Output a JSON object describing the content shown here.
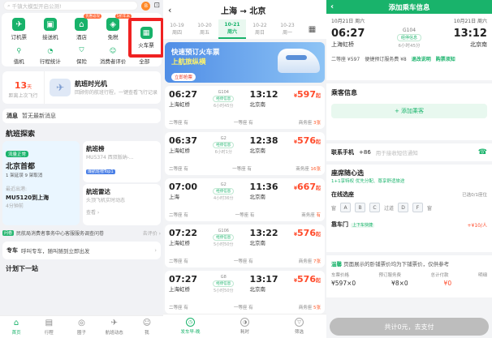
{
  "home": {
    "search_placeholder": "千镇大模型开启公测!",
    "avatar_initial": "B",
    "grid": [
      {
        "label": "订机票",
        "icon": "✈",
        "badge": ""
      },
      {
        "label": "接送机",
        "icon": "🚘",
        "badge": ""
      },
      {
        "label": "酒店",
        "icon": "🏨",
        "badge": "优惠返现"
      },
      {
        "label": "免税",
        "icon": "🛍",
        "badge": "5折年末"
      }
    ],
    "train_label": "火车票",
    "grid2": [
      {
        "label": "值机",
        "icon": "🧳"
      },
      {
        "label": "行程统计",
        "icon": "📊"
      },
      {
        "label": "保险",
        "icon": "🛡"
      },
      {
        "label": "消费者评价",
        "icon": "💬"
      },
      {
        "label": "全部",
        "icon": "⋯"
      }
    ],
    "time_card": {
      "count": "13",
      "unit": "天",
      "sub": "距离上次飞行",
      "title": "航班时光机",
      "desc": "回顾你的航班行程，一键查看飞行记录"
    },
    "messages": {
      "title": "消息",
      "text": "暂无最新消息"
    },
    "explore": {
      "title": "航班探索",
      "status_tag": "流量正常",
      "airport": "北京首都",
      "stats": "1 架延误   9 架取消",
      "recent_label": "最近出港:",
      "flight": "MU5120到上海",
      "flight_time": "4分钟前",
      "rank_title": "航班榜",
      "rank_sub": "MU5374  西双版纳-...",
      "rank_tag": "爆航班榜Top1",
      "radar_title": "航班雷达",
      "radar_sub": "头顶飞机实时动态",
      "radar_link": "查看 ›"
    },
    "ad": {
      "tag": "问卷",
      "text": "民航局消费者事务中心客服服务调查问卷",
      "link": "去评价 ›"
    },
    "car": {
      "title": "专车",
      "text": "呼叫专车，随叫随到立即出发"
    },
    "plan": "计划下一站",
    "tabs": [
      "首页",
      "行程",
      "圈子",
      "航班动态",
      "我"
    ]
  },
  "list": {
    "title": "上海 → 北京",
    "dates": [
      {
        "d": "10-19",
        "w": "周四"
      },
      {
        "d": "10-20",
        "w": "周五"
      },
      {
        "d": "10-21",
        "w": "周六"
      },
      {
        "d": "10-22",
        "w": "周日"
      },
      {
        "d": "10-23",
        "w": "周一"
      }
    ],
    "banner": {
      "l1": "快速预订火车票",
      "l2": "上航旅纵横",
      "l3": "立即抢票"
    },
    "trains": [
      {
        "dep": "06:27",
        "from": "上海虹桥",
        "no": "G104",
        "stop": "经停信息",
        "dur": "6小时45分",
        "arr": "13:12",
        "to": "北京南",
        "price": "597",
        "seat2": "二等座",
        "seat2n": "有",
        "seat1": "一等座",
        "seat1n": "有",
        "biz": "商务座",
        "bizn": "3张"
      },
      {
        "dep": "06:37",
        "from": "上海虹桥",
        "no": "G2",
        "stop": "经停信息",
        "dur": "6小时1分",
        "arr": "12:38",
        "to": "北京南",
        "price": "576",
        "seat2": "二等座",
        "seat2n": "有",
        "seat1": "一等座",
        "seat1n": "有",
        "biz": "商务座",
        "bizn": "16张"
      },
      {
        "dep": "07:00",
        "from": "上海",
        "no": "G2",
        "stop": "经停信息",
        "dur": "4小时36分",
        "arr": "11:36",
        "to": "北京南",
        "price": "667",
        "seat2": "二等座",
        "seat2n": "有",
        "seat1": "一等座",
        "seat1n": "有",
        "biz": "商务座",
        "bizn": "有"
      },
      {
        "dep": "07:22",
        "from": "上海虹桥",
        "no": "G106",
        "stop": "经停信息",
        "dur": "5小时50分",
        "arr": "13:22",
        "to": "北京南",
        "price": "576",
        "seat2": "二等座",
        "seat2n": "有",
        "seat1": "一等座",
        "seat1n": "有",
        "biz": "商务座",
        "bizn": "7张"
      },
      {
        "dep": "07:27",
        "from": "上海虹桥",
        "no": "G8",
        "stop": "经停信息",
        "dur": "5小时50分",
        "arr": "13:17",
        "to": "北京南",
        "price": "576",
        "seat2": "二等座",
        "seat2n": "有",
        "seat1": "一等座",
        "seat1n": "有",
        "biz": "商务座",
        "bizn": "5张"
      }
    ],
    "footer": [
      "发车早-晚",
      "耗时",
      "筛选"
    ]
  },
  "order": {
    "title": "添加乘车信息",
    "dep_date": "10月21日 周六",
    "arr_date": "10月21日 周六",
    "dep_time": "06:27",
    "arr_time": "13:12",
    "from": "上海虹桥",
    "to": "北京南",
    "train_no": "G104",
    "stop": "经停信息",
    "duration": "6小时45分",
    "price_line": "二等座 ¥597",
    "fee_line": "便捷预订服务费 ¥8",
    "refund": "退改说明",
    "notice": "购票须知",
    "passenger_title": "乘客信息",
    "add_passenger": "+ 添加乘客",
    "contact_label": "联系手机",
    "contact_code": "+86",
    "contact_placeholder": "用于接收短信通知",
    "seat_title": "座席随心选",
    "seat_desc": "1+1享特权  优先分配、尊享舒适旅途",
    "online_label": "在线选座",
    "online_status": "已选0/1座位",
    "seats_left": [
      "A",
      "B",
      "C"
    ],
    "aisle": "过道",
    "seats_right": [
      "D",
      "F"
    ],
    "window": "窗",
    "door_label": "靠车门",
    "door_tag": "上下车快捷",
    "door_price": "+¥10/人",
    "tip_head": "温馨",
    "tip_text": "页面展示的卧铺票价均为下铺票价，仅供参考",
    "fee_labels": [
      "车票价格",
      "预订服务费",
      "总计付款"
    ],
    "fee_values": [
      "¥597×0",
      "¥8×0",
      "¥0"
    ],
    "detail": "明细",
    "pay_button": "共计0元，去支付"
  }
}
